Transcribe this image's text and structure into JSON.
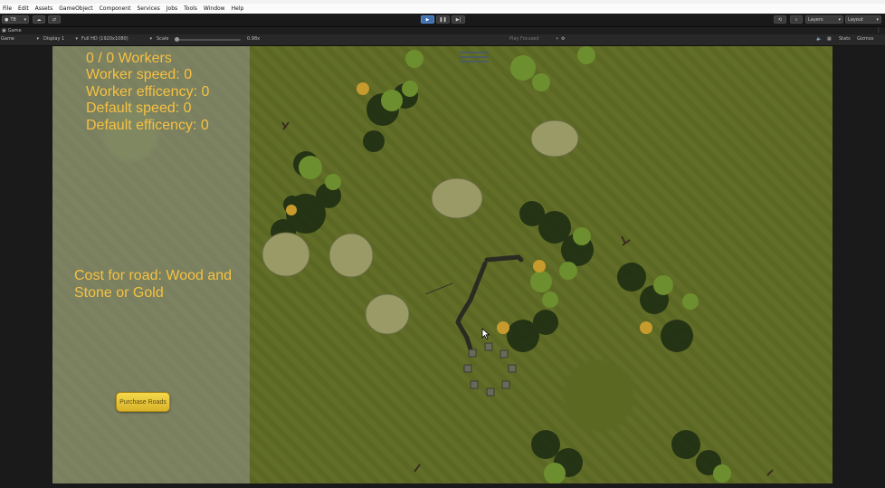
{
  "menu": {
    "items": [
      "File",
      "Edit",
      "Assets",
      "GameObject",
      "Component",
      "Services",
      "Jobs",
      "Tools",
      "Window",
      "Help"
    ]
  },
  "toolbar": {
    "account_label": "TB",
    "play_icon": "play-icon",
    "pause_icon": "pause-icon",
    "step_icon": "step-icon",
    "layers_label": "Layers",
    "layout_label": "Layout",
    "colors": {
      "play_active": "#3e6fae"
    }
  },
  "tab": {
    "game_label": "Game"
  },
  "gamebar": {
    "view_label": "Game",
    "display_label": "Display 1",
    "resolution_label": "Full HD (1920x1080)",
    "scale_label": "Scale",
    "scale_value": "0.98x",
    "play_focused_label": "Play Focused",
    "stats_label": "Stats",
    "gizmos_label": "Gizmos"
  },
  "hud": {
    "workers": "0 / 0 Workers",
    "worker_speed": "Worker speed: 0",
    "worker_efficiency": "Worker efficency: 0",
    "default_speed": "Default speed: 0",
    "default_efficiency": "Default efficency: 0",
    "cost_text": "Cost for road:  Wood and Stone or  Gold",
    "purchase_button": "Purchase Roads",
    "text_color": "#f6c142"
  }
}
